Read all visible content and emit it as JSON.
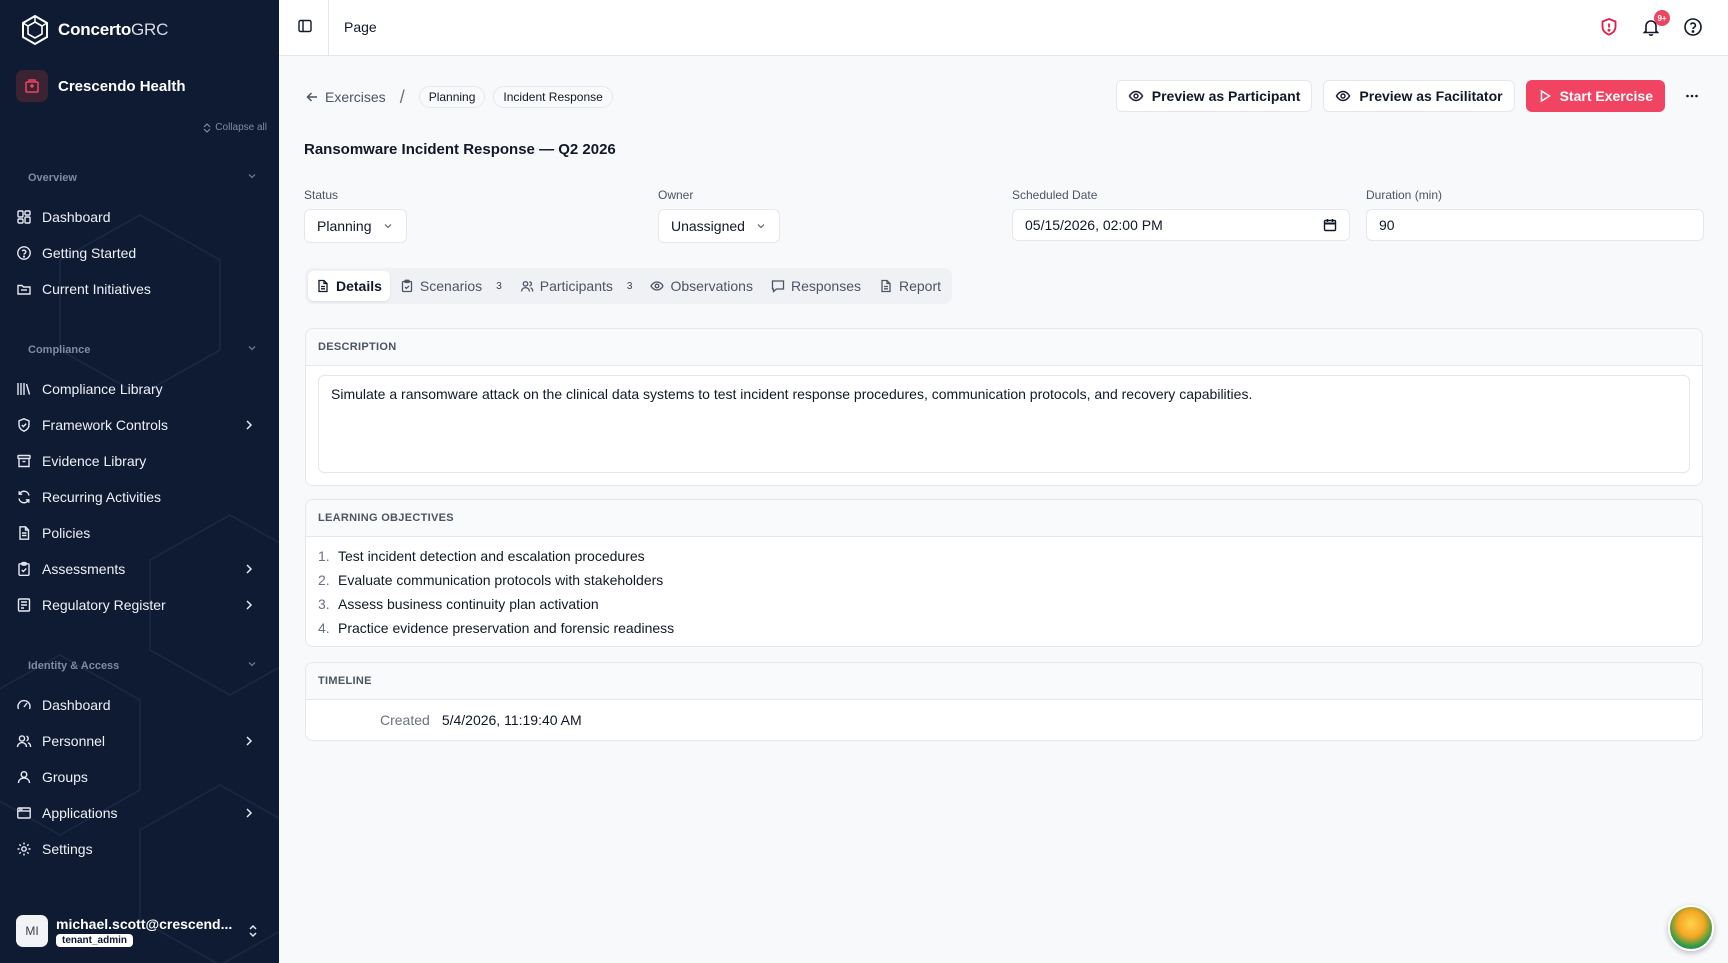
{
  "brand": {
    "name_bold": "Concerto",
    "name_light": "GRC"
  },
  "tenant": {
    "name": "Crescendo Health"
  },
  "sidebar": {
    "collapse_all": "Collapse all",
    "sections": [
      {
        "label": "Overview",
        "items": [
          {
            "label": "Dashboard",
            "icon": "dashboard-icon"
          },
          {
            "label": "Getting Started",
            "icon": "help-circle-icon"
          },
          {
            "label": "Current Initiatives",
            "icon": "folder-icon"
          }
        ]
      },
      {
        "label": "Compliance",
        "items": [
          {
            "label": "Compliance Library",
            "icon": "library-icon"
          },
          {
            "label": "Framework Controls",
            "icon": "shield-check-icon",
            "has_children": true
          },
          {
            "label": "Evidence Library",
            "icon": "archive-icon"
          },
          {
            "label": "Recurring Activities",
            "icon": "refresh-icon"
          },
          {
            "label": "Policies",
            "icon": "file-text-icon"
          },
          {
            "label": "Assessments",
            "icon": "clipboard-icon",
            "has_children": true
          },
          {
            "label": "Regulatory Register",
            "icon": "register-icon",
            "has_children": true
          }
        ]
      },
      {
        "label": "Identity & Access",
        "items": [
          {
            "label": "Dashboard",
            "icon": "gauge-icon"
          },
          {
            "label": "Personnel",
            "icon": "users-icon",
            "has_children": true
          },
          {
            "label": "Groups",
            "icon": "user-group-icon"
          },
          {
            "label": "Applications",
            "icon": "app-window-icon",
            "has_children": true
          },
          {
            "label": "Settings",
            "icon": "gear-icon"
          }
        ]
      }
    ]
  },
  "user": {
    "initials": "MI",
    "email": "michael.scott@crescend...",
    "role": "tenant_admin"
  },
  "topbar": {
    "page_label": "Page",
    "notif_count": "9+"
  },
  "breadcrumb": {
    "back": "Exercises",
    "separator": "/",
    "status_pill": "Planning",
    "type_pill": "Incident Response"
  },
  "actions": {
    "preview_participant": "Preview as Participant",
    "preview_facilitator": "Preview as Facilitator",
    "start": "Start Exercise"
  },
  "exercise": {
    "title": "Ransomware Incident Response — Q2 2026",
    "status_label": "Status",
    "status_value": "Planning",
    "owner_label": "Owner",
    "owner_value": "Unassigned",
    "date_label": "Scheduled Date",
    "date_value": "05/15/2026, 02:00 PM",
    "duration_label": "Duration (min)",
    "duration_value": "90"
  },
  "tabs": [
    {
      "label": "Details",
      "icon": "file-icon",
      "active": true,
      "count": ""
    },
    {
      "label": "Scenarios",
      "icon": "clipboard-icon",
      "count": "3"
    },
    {
      "label": "Participants",
      "icon": "users-icon",
      "count": "3"
    },
    {
      "label": "Observations",
      "icon": "eye-icon",
      "count": ""
    },
    {
      "label": "Responses",
      "icon": "message-icon",
      "count": ""
    },
    {
      "label": "Report",
      "icon": "file-text-icon",
      "count": ""
    }
  ],
  "description": {
    "header": "DESCRIPTION",
    "text": "Simulate a ransomware attack on the clinical data systems to test incident response procedures, communication protocols, and recovery capabilities."
  },
  "objectives": {
    "header": "LEARNING OBJECTIVES",
    "items": [
      {
        "num": "1.",
        "text": "Test incident detection and escalation procedures"
      },
      {
        "num": "2.",
        "text": "Evaluate communication protocols with stakeholders"
      },
      {
        "num": "3.",
        "text": "Assess business continuity plan activation"
      },
      {
        "num": "4.",
        "text": "Practice evidence preservation and forensic readiness"
      }
    ]
  },
  "timeline": {
    "header": "TIMELINE",
    "created_label": "Created",
    "created_value": "5/4/2026, 11:19:40 AM"
  },
  "colors": {
    "sidebar_bg": "#0f1b33",
    "accent": "#f04462",
    "alert_red": "#e11d48"
  }
}
